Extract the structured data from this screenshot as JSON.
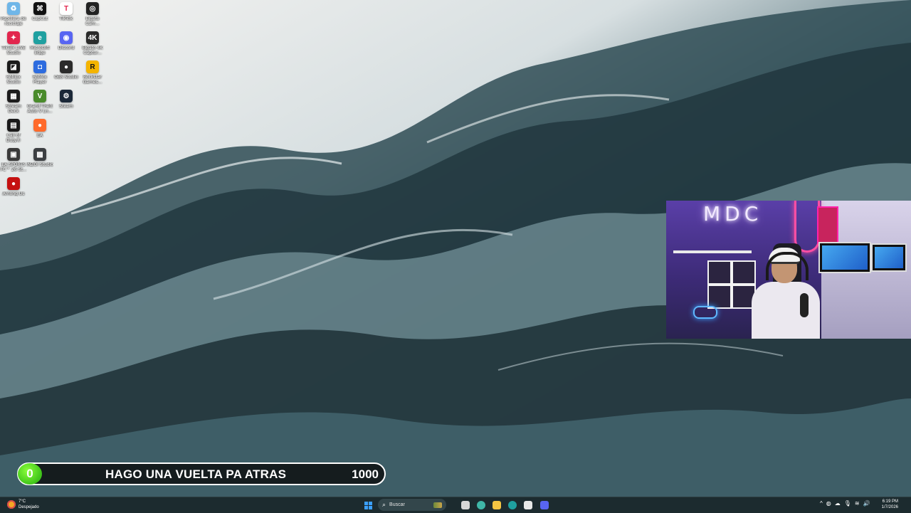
{
  "desktop": {
    "icons": [
      {
        "label": "Papelera de reciclaje",
        "icon": "recycle-bin-icon",
        "color": "#6fb6e8",
        "glyph": "♻"
      },
      {
        "label": "CapCut",
        "icon": "capcut-icon",
        "color": "#111111",
        "glyph": "⌘"
      },
      {
        "label": "TikTok",
        "icon": "tiktok-icon",
        "color": "#ffffff",
        "glyph": "T"
      },
      {
        "label": "Elgato Cam...",
        "icon": "elgato-camera-icon",
        "color": "#222222",
        "glyph": "◎"
      },
      {
        "label": "TikTok LIVE Studio",
        "icon": "tiktok-live-studio-icon",
        "color": "#e2264d",
        "glyph": "✦"
      },
      {
        "label": "Microsoft Edge",
        "icon": "edge-icon",
        "color": "#1fa0a0",
        "glyph": "e"
      },
      {
        "label": "Discord",
        "icon": "discord-icon",
        "color": "#5865f2",
        "glyph": "◉"
      },
      {
        "label": "Elgato 4K Captur...",
        "icon": "elgato-4k-capture-icon",
        "color": "#2a2a2a",
        "glyph": "4K"
      },
      {
        "label": "Roblox Studio",
        "icon": "roblox-studio-icon",
        "color": "#1b1b1b",
        "glyph": "◪"
      },
      {
        "label": "Roblox Player",
        "icon": "roblox-player-icon",
        "color": "#2d6cdf",
        "glyph": "◘"
      },
      {
        "label": "OBS Studio",
        "icon": "obs-studio-icon",
        "color": "#2b2b2b",
        "glyph": "●"
      },
      {
        "label": "Rockstar Games...",
        "icon": "rockstar-games-icon",
        "color": "#f4b400",
        "glyph": "R"
      },
      {
        "label": "Stream Deck",
        "icon": "stream-deck-icon",
        "color": "#1c1c1c",
        "glyph": "▦"
      },
      {
        "label": "Grand Theft Auto V Ln...",
        "icon": "gta-v-icon",
        "color": "#4a8b2b",
        "glyph": "V"
      },
      {
        "label": "Steam",
        "icon": "steam-icon",
        "color": "#1b2838",
        "glyph": "⚙"
      },
      {
        "label": "Call of Duty®",
        "icon": "call-of-duty-icon",
        "color": "#1a1a1a",
        "glyph": "▤"
      },
      {
        "label": "EA",
        "icon": "ea-icon",
        "color": "#ff6a2b",
        "glyph": "●"
      },
      {
        "label": "EA SPORTS FC™ 26 St...",
        "icon": "ea-sports-fc-icon",
        "color": "#3a3a3a",
        "glyph": "▣"
      },
      {
        "label": "INZOI Studio",
        "icon": "inzoi-icon",
        "color": "#3c3f42",
        "glyph": "▩"
      },
      {
        "label": "Among Us",
        "icon": "among-us-icon",
        "color": "#c51111",
        "glyph": "●"
      }
    ]
  },
  "webcam": {
    "neon_text": "MDC"
  },
  "goal": {
    "count": "0",
    "title": "HAGO UNA VUELTA PA ATRAS",
    "target": "1000"
  },
  "taskbar": {
    "weather_temp": "7°C",
    "weather_condition": "Despejado",
    "search_placeholder": "Buscar",
    "pinned_apps": [
      {
        "name": "task-view-icon",
        "color": "#d7d7d7"
      },
      {
        "name": "copilot-icon",
        "color": "#3fb7a8"
      },
      {
        "name": "file-explorer-icon",
        "color": "#f4c542"
      },
      {
        "name": "edge-taskbar-icon",
        "color": "#1fa0a0"
      },
      {
        "name": "microsoft-store-icon",
        "color": "#e8e8e8"
      },
      {
        "name": "discord-taskbar-icon",
        "color": "#5865f2"
      }
    ],
    "tray_icons": [
      {
        "name": "chevron-up-icon",
        "glyph": "^"
      },
      {
        "name": "network-tray-icon",
        "glyph": "◍"
      },
      {
        "name": "cloud-tray-icon",
        "glyph": "☁"
      },
      {
        "name": "microphone-tray-icon",
        "glyph": "🎙"
      },
      {
        "name": "wifi-tray-icon",
        "glyph": "≋"
      },
      {
        "name": "volume-tray-icon",
        "glyph": "🔊"
      }
    ],
    "clock_time": "6:19 PM",
    "clock_date": "1/7/2026"
  }
}
